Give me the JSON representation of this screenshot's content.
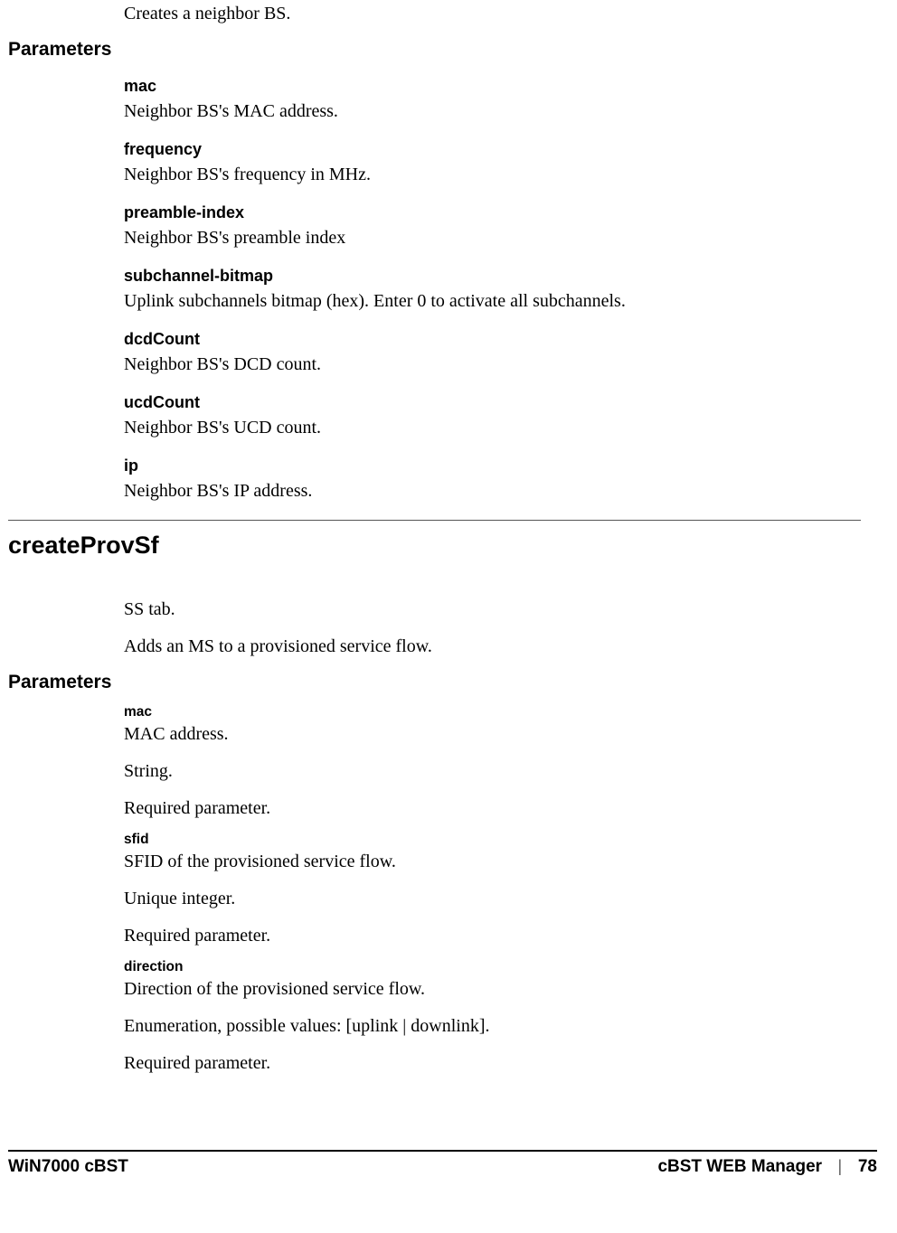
{
  "intro": {
    "desc": "Creates a neighbor BS."
  },
  "parameters_heading": "Parameters",
  "neighbor_params": [
    {
      "name": "mac",
      "desc": "Neighbor BS's MAC address."
    },
    {
      "name": "frequency",
      "desc": "Neighbor BS's frequency in MHz."
    },
    {
      "name": "preamble-index",
      "desc": "Neighbor BS's preamble index"
    },
    {
      "name": "subchannel-bitmap",
      "desc": "Uplink subchannels bitmap (hex). Enter  0 to activate all subchannels."
    },
    {
      "name": "dcdCount",
      "desc": "Neighbor BS's DCD count."
    },
    {
      "name": "ucdCount",
      "desc": "Neighbor BS's UCD count."
    },
    {
      "name": "ip",
      "desc": "Neighbor BS's IP address."
    }
  ],
  "section2": {
    "title": "createProvSf",
    "tab_line": "SS tab.",
    "desc": "Adds an MS to a provisioned service flow.",
    "parameters_heading": "Parameters",
    "params": [
      {
        "name": "mac",
        "lines": [
          "MAC address.",
          "String.",
          "Required parameter."
        ]
      },
      {
        "name": "sfid",
        "lines": [
          "SFID of the provisioned service flow.",
          "Unique integer.",
          "Required parameter."
        ]
      },
      {
        "name": "direction",
        "lines": [
          "Direction of the provisioned service flow.",
          "Enumeration, possible values: [uplink | downlink].",
          "Required parameter."
        ]
      }
    ]
  },
  "footer": {
    "left": "WiN7000 cBST",
    "right_label": "cBST WEB Manager",
    "separator": "|",
    "page": "78"
  }
}
